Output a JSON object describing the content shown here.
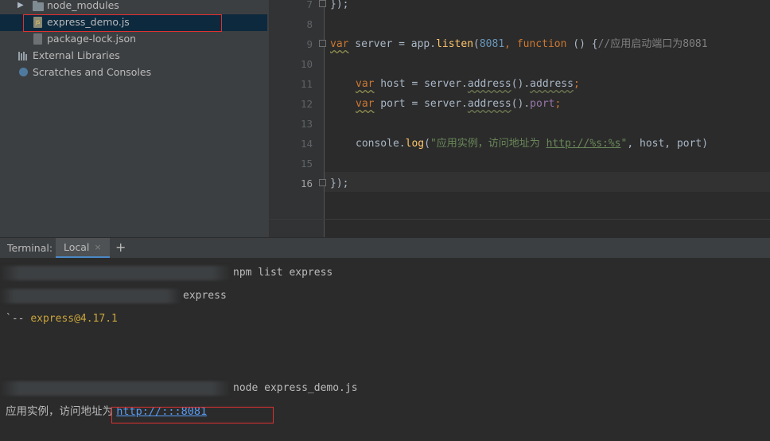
{
  "project_tree": {
    "items": [
      {
        "label": "node_modules",
        "icon": "folder-icon"
      },
      {
        "label": "express_demo.js",
        "icon": "js-file-icon"
      },
      {
        "label": "package-lock.json",
        "icon": "json-file-icon"
      },
      {
        "label": "External Libraries",
        "icon": "libraries-icon"
      },
      {
        "label": "Scratches and Consoles",
        "icon": "scratches-icon"
      }
    ]
  },
  "editor": {
    "line_numbers": [
      "7",
      "8",
      "9",
      "10",
      "11",
      "12",
      "13",
      "14",
      "15",
      "16"
    ],
    "active_line": "16",
    "lines": {
      "l7": "});",
      "l9_kw": "var",
      "l9_a": " server = app.",
      "l9_fn": "listen",
      "l9_b": "(",
      "l9_num": "8081",
      "l9_c": ", ",
      "l9_fnkw": "function",
      "l9_d": " () {",
      "l9_cmt": "//应用启动端口为8081",
      "l11_kw": "var",
      "l11_a": " host = server.",
      "l11_m": "address",
      "l11_b": "().",
      "l11_p": "address",
      "l11_semi": ";",
      "l12_kw": "var",
      "l12_a": " port = server.",
      "l12_m": "address",
      "l12_b": "().",
      "l12_p": "port",
      "l12_semi": ";",
      "l14_a": "console.",
      "l14_fn": "log",
      "l14_b": "(",
      "l14_str1": "\"应用实例，访问地址为 ",
      "l14_url": "http://%s:%s",
      "l14_str2": "\"",
      "l14_c": ", host, port)",
      "l16": "});"
    }
  },
  "terminal": {
    "title": "Terminal:",
    "tab_label": "Local",
    "tab_close": "×",
    "add": "+",
    "lines": {
      "cmd1": "npm list express",
      "out1": "express",
      "out2_prefix": "`-- ",
      "out2_pkg": "express@4.17.1",
      "cmd2": "node express_demo.js",
      "out3_text": "应用实例，访问地址为 ",
      "out3_url": "http://:::8081"
    }
  },
  "colors": {
    "keyword": "#cc7832",
    "number": "#6897bb",
    "function": "#ffc66d",
    "property": "#9876aa",
    "string": "#6a8759",
    "comment": "#808080",
    "highlight_box": "#e03030"
  }
}
